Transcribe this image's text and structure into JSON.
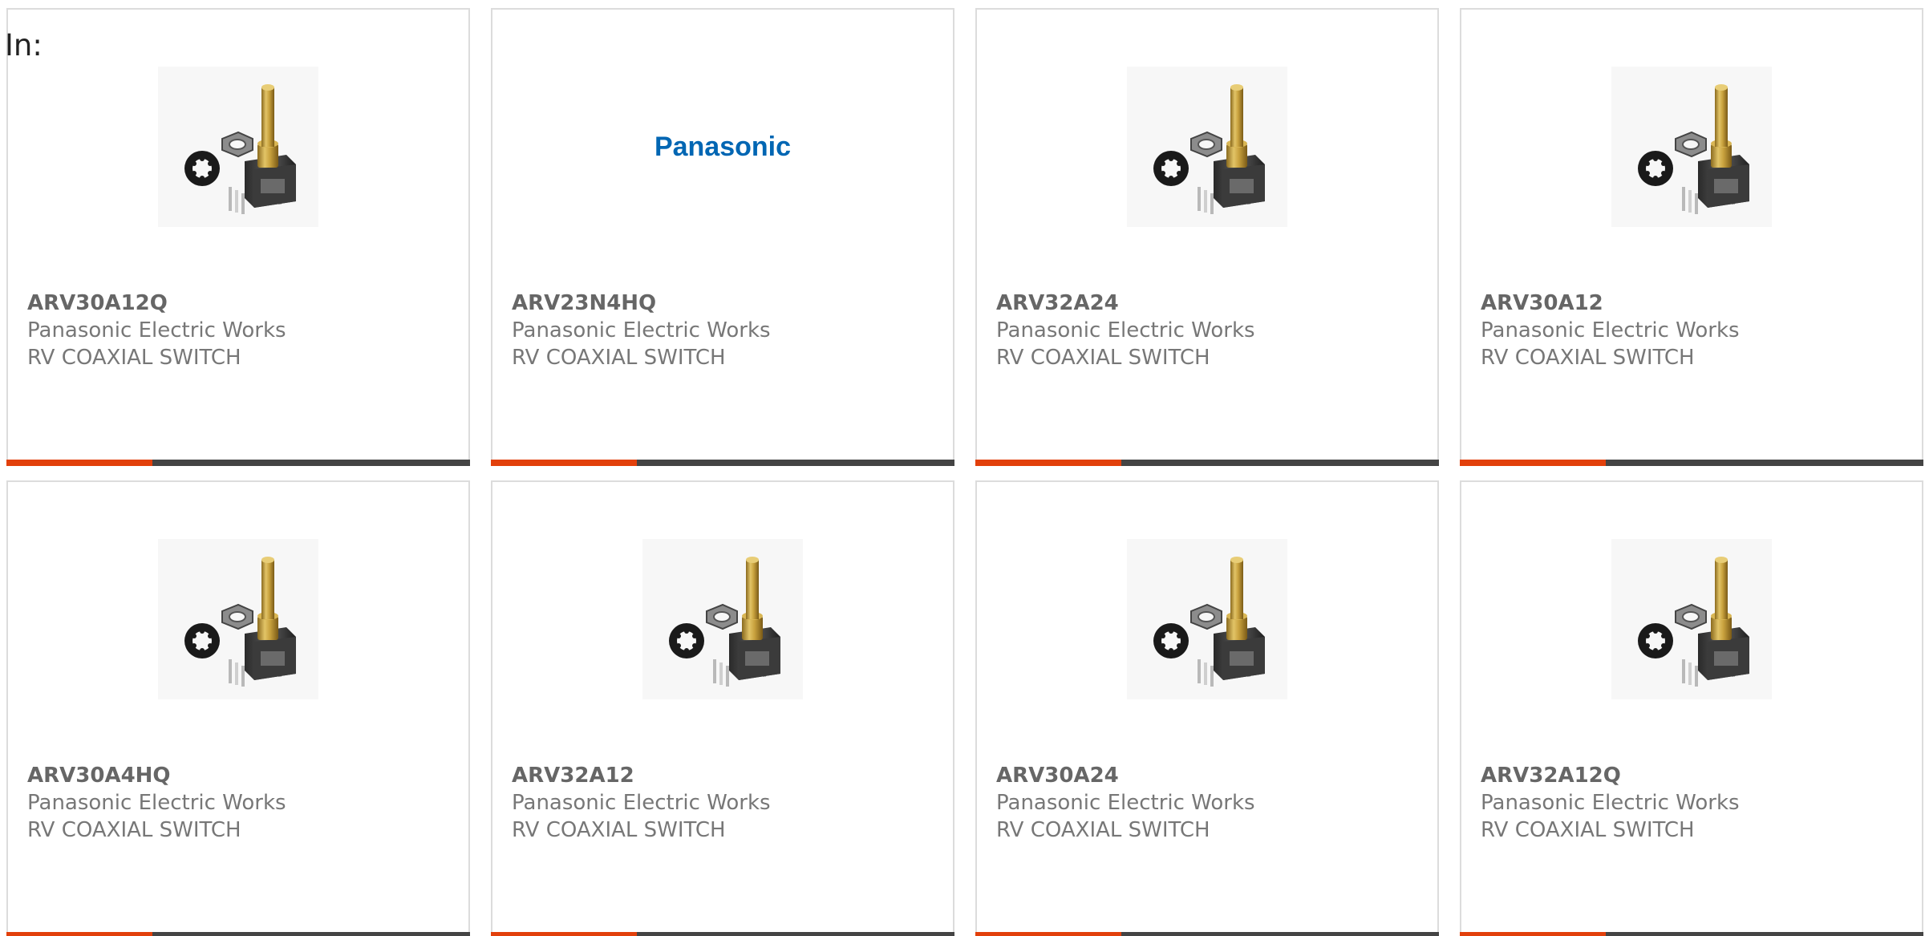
{
  "header": {
    "in_label": "In:"
  },
  "theme": {
    "accent": "#e2400b",
    "bar": "#444444",
    "brand_blue": "#0066b3"
  },
  "products": [
    {
      "part_number": "ARV30A12Q",
      "manufacturer": "Panasonic Electric Works",
      "description": "RV COAXIAL SWITCH",
      "image": "rotary-encoder-image"
    },
    {
      "part_number": "ARV23N4HQ",
      "manufacturer": "Panasonic Electric Works",
      "description": "RV COAXIAL SWITCH",
      "image": "panasonic-logo",
      "logo_text": "Panasonic"
    },
    {
      "part_number": "ARV32A24",
      "manufacturer": "Panasonic Electric Works",
      "description": "RV COAXIAL SWITCH",
      "image": "rotary-encoder-image"
    },
    {
      "part_number": "ARV30A12",
      "manufacturer": "Panasonic Electric Works",
      "description": "RV COAXIAL SWITCH",
      "image": "rotary-encoder-image"
    },
    {
      "part_number": "ARV30A4HQ",
      "manufacturer": "Panasonic Electric Works",
      "description": "RV COAXIAL SWITCH",
      "image": "rotary-encoder-image"
    },
    {
      "part_number": "ARV32A12",
      "manufacturer": "Panasonic Electric Works",
      "description": "RV COAXIAL SWITCH",
      "image": "rotary-encoder-image"
    },
    {
      "part_number": "ARV30A24",
      "manufacturer": "Panasonic Electric Works",
      "description": "RV COAXIAL SWITCH",
      "image": "rotary-encoder-image"
    },
    {
      "part_number": "ARV32A12Q",
      "manufacturer": "Panasonic Electric Works",
      "description": "RV COAXIAL SWITCH",
      "image": "rotary-encoder-image"
    }
  ]
}
